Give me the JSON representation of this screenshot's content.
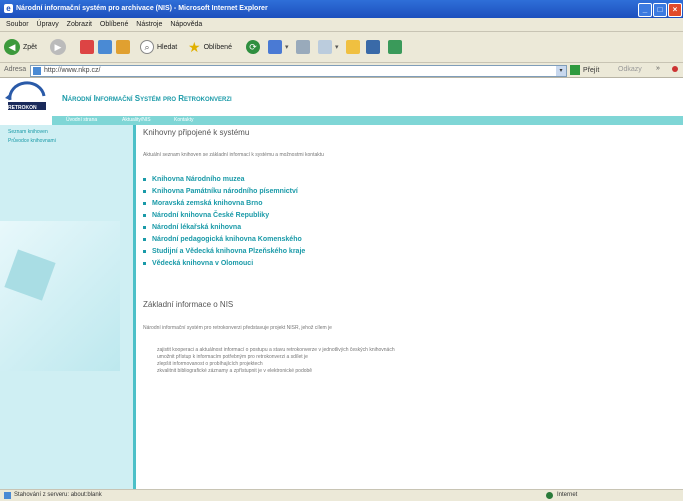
{
  "window": {
    "title": "Národní informační systém pro archivace (NIS) - Microsoft Internet Explorer"
  },
  "menu": [
    "Soubor",
    "Úpravy",
    "Zobrazit",
    "Oblíbené",
    "Nástroje",
    "Nápověda"
  ],
  "toolbar": {
    "back": "Zpět",
    "search": "Hledat",
    "favorites": "Oblíbené"
  },
  "address": {
    "label": "Adresa",
    "url": "http://www.nkp.cz/",
    "go": "Přejít",
    "links": "Odkazy"
  },
  "site": {
    "title": "Národní Informační Systém pro Retrokonverzi",
    "logo_text": "RETROKON",
    "nav": [
      "Úvodní strana",
      "Aktuality/NIS",
      "Kontakty"
    ],
    "sidebar": [
      "Seznam knihoven",
      "Průvodce knihovnami"
    ]
  },
  "content": {
    "heading": "Knihovny připojené k systému",
    "intro": "Aktuální seznam knihoven se základní informací k systému a možnostmi kontaktu",
    "libraries": [
      "Knihovna Národního muzea",
      "Knihovna Památníku národního písemnictví",
      "Moravská zemská knihovna Brno",
      "Národní knihovna České Republiky",
      "Národní lékařská knihovna",
      "Národní pedagogická knihovna Komenského",
      "Studijní a Vědecká knihovna Plzeňského kraje",
      "Vědecká knihovna v Olomouci"
    ],
    "info_heading": "Základní informace o NIS",
    "info_intro": "Národní informační systém pro retrokonverzi představuje projekt NISR, jehož cílem je",
    "info_bullets": [
      "zajistit kooperaci a aktuálnost informací o postupu a stavu retrokonverze v jednotlivých českých knihovnách",
      "umožnit přístup k informacím potřebným pro retrokonverzi a sdílet je",
      "zlepšit informovanost o probíhajících projektech",
      "zkvalitnit bibliografické záznamy a zpřístupnit je v elektronické podobě"
    ]
  },
  "status": {
    "left": "Stahování z serveru: about:blank",
    "zone": "Internet"
  },
  "colors": {
    "accent": "#1a9aa8",
    "sidebar": "#cfeff3",
    "nav_strip": "#7fd6d6",
    "title_bar": "#1c4fbd"
  }
}
